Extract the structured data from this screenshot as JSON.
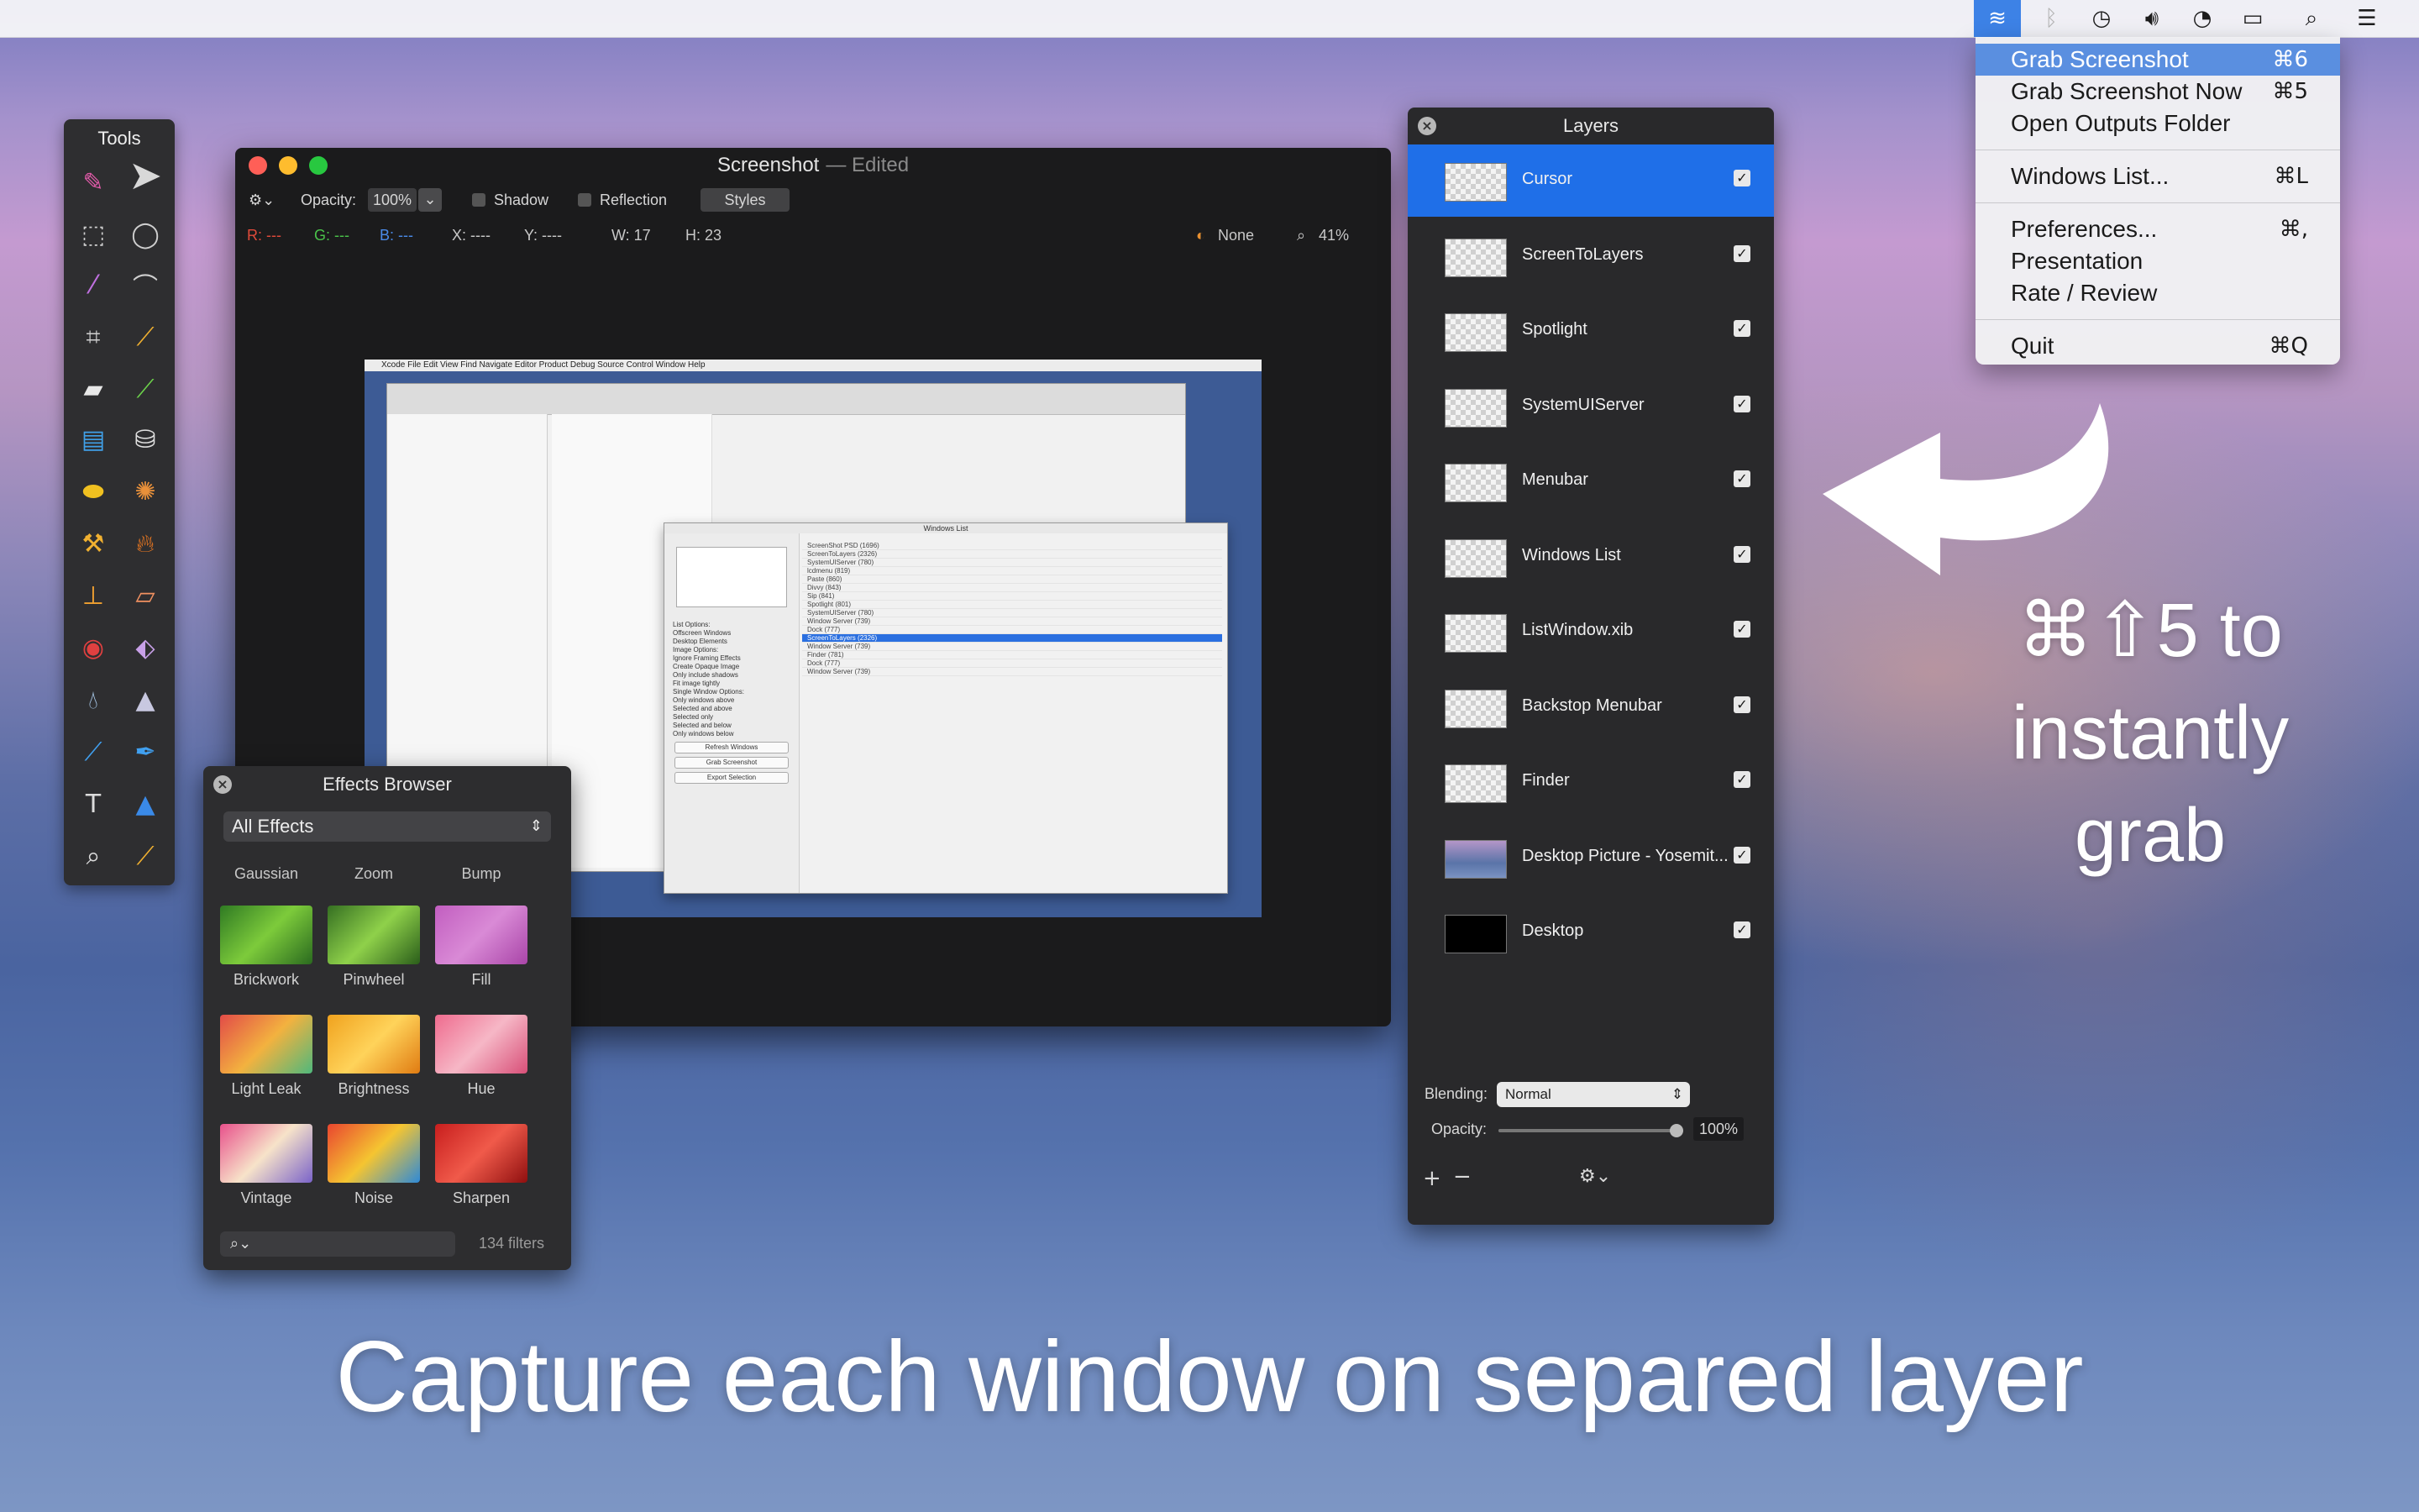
{
  "menu": {
    "items": [
      {
        "label": "Grab Screenshot",
        "shortcut": "⌘6"
      },
      {
        "label": "Grab Screenshot Now",
        "shortcut": "⌘5"
      },
      {
        "label": "Open Outputs Folder",
        "shortcut": ""
      },
      {
        "label": "Windows List...",
        "shortcut": "⌘L"
      },
      {
        "label": "Preferences...",
        "shortcut": "⌘,"
      },
      {
        "label": "Presentation",
        "shortcut": ""
      },
      {
        "label": "Rate / Review",
        "shortcut": ""
      },
      {
        "label": "Quit",
        "shortcut": "⌘Q"
      }
    ]
  },
  "tools": {
    "title": "Tools"
  },
  "main_window": {
    "title": "Screenshot",
    "edited": "— Edited",
    "opacity_label": "Opacity:",
    "opacity_value": "100%",
    "shadow": "Shadow",
    "reflection": "Reflection",
    "styles": "Styles",
    "info": {
      "r": "R: ---",
      "g": "G: ---",
      "b": "B: ---",
      "x": "X: ----",
      "y": "Y: ----",
      "w": "W:  17",
      "h": "H:  23",
      "none": "None",
      "zoom": "41%"
    }
  },
  "mini_shot": {
    "menubar": "Xcode   File   Edit   View   Find   Navigate   Editor   Product   Debug   Source Control   Window   Help",
    "windows_list_title": "Windows List",
    "rows": [
      "ScreenShot PSD (1696)",
      "ScreenToLayers (2326)",
      "SystemUIServer (780)",
      "lcdmenu (819)",
      "Paste (860)",
      "Divvy (843)",
      "Sip (841)",
      "Spotlight (801)",
      "SystemUIServer (780)",
      "Window Server (739)",
      "Dock (777)",
      "ScreenToLayers (2326)",
      "Window Server (739)",
      "Finder (781)",
      "Dock (777)",
      "Window Server (739)"
    ],
    "options": [
      "List Options:",
      "Offscreen Windows",
      "Desktop Elements",
      "Image Options:",
      "Ignore Framing Effects",
      "Create Opaque Image",
      "Only include shadows",
      "Fit image tightly",
      "Single Window Options:",
      "Only windows above",
      "Selected and above",
      "Selected only",
      "Selected and below",
      "Only windows below"
    ],
    "buttons": [
      "Refresh Windows",
      "Grab Screenshot",
      "Export Selection"
    ]
  },
  "effects": {
    "title": "Effects Browser",
    "filter": "All Effects",
    "top_row": [
      "Gaussian",
      "Zoom",
      "Bump"
    ],
    "items": [
      {
        "label": "Brickwork",
        "colors": [
          "#2f7a23",
          "#7dcb3b",
          "#2a6a1f"
        ]
      },
      {
        "label": "Pinwheel",
        "colors": [
          "#356f22",
          "#8fd14a",
          "#2a5d1a"
        ]
      },
      {
        "label": "Fill",
        "colors": [
          "#c25ec0",
          "#d98ad6",
          "#a945a8"
        ]
      },
      {
        "label": "Light Leak",
        "colors": [
          "#e24b48",
          "#f3b23f",
          "#4fb87c"
        ]
      },
      {
        "label": "Brightness",
        "colors": [
          "#f0a21e",
          "#ffd35a",
          "#e07b12"
        ]
      },
      {
        "label": "Hue",
        "colors": [
          "#ef6b8e",
          "#f6b7c6",
          "#d84f78"
        ]
      },
      {
        "label": "Vintage",
        "colors": [
          "#e8508b",
          "#f7e3c9",
          "#7a63c9"
        ]
      },
      {
        "label": "Noise",
        "colors": [
          "#e9452f",
          "#f5c531",
          "#2e8ad8"
        ]
      },
      {
        "label": "Sharpen",
        "colors": [
          "#c81e1e",
          "#f05a4a",
          "#8f0f0f"
        ]
      }
    ],
    "search_icon": "⌕⌄",
    "count": "134 filters"
  },
  "layers": {
    "title": "Layers",
    "items": [
      {
        "name": "Cursor",
        "selected": true
      },
      {
        "name": "ScreenToLayers",
        "selected": false
      },
      {
        "name": "Spotlight",
        "selected": false
      },
      {
        "name": "SystemUIServer",
        "selected": false
      },
      {
        "name": "Menubar",
        "selected": false
      },
      {
        "name": "Windows List",
        "selected": false
      },
      {
        "name": "ListWindow.xib",
        "selected": false
      },
      {
        "name": "Backstop Menubar",
        "selected": false
      },
      {
        "name": "Finder",
        "selected": false
      },
      {
        "name": "Desktop Picture - Yosemit...",
        "selected": false
      },
      {
        "name": "Desktop",
        "selected": false
      }
    ],
    "blending_label": "Blending:",
    "blending_value": "Normal",
    "opacity_label": "Opacity:",
    "opacity_value": "100%",
    "opacity_level": 1.0
  },
  "promo": {
    "line1": "⌘⇧5 to",
    "line2": "instantly",
    "line3": "grab"
  },
  "caption": "Capture each window on separed layer",
  "colors": {
    "accent": "#1f6fe8",
    "menu_highlight": "#5a8fe0"
  }
}
